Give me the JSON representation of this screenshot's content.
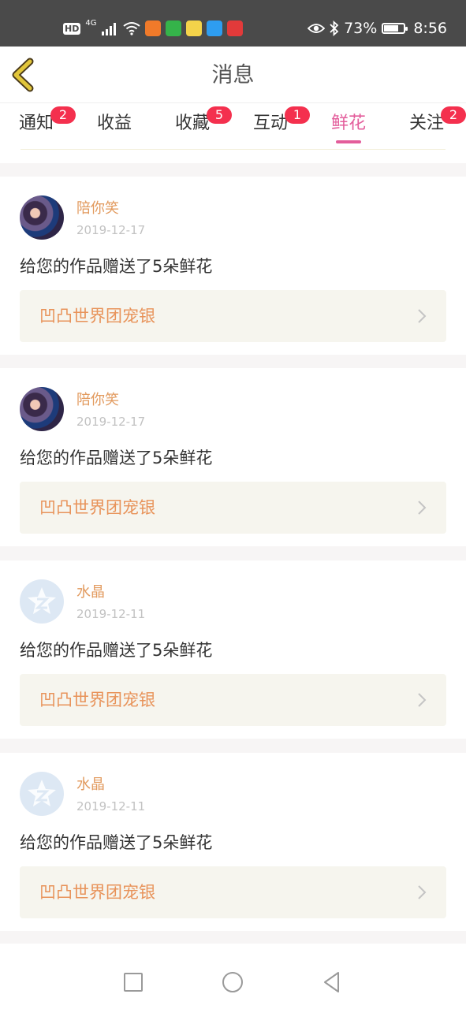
{
  "status_bar": {
    "hd": "HD",
    "network": "4G",
    "battery_text": "73%",
    "battery_level": 0.73,
    "time": "8:56",
    "icons": [
      "signal-icon",
      "wifi-icon",
      "eye-icon",
      "bluetooth-icon",
      "battery-icon"
    ]
  },
  "header": {
    "title": "消息",
    "back_icon": "chevron-left-icon",
    "accent": "#e2c63a"
  },
  "tabs": [
    {
      "label": "通知",
      "badge": "2"
    },
    {
      "label": "收益",
      "badge": ""
    },
    {
      "label": "收藏",
      "badge": "5"
    },
    {
      "label": "互动",
      "badge": "1"
    },
    {
      "label": "鲜花",
      "badge": "",
      "active": true
    },
    {
      "label": "关注",
      "badge": "2"
    }
  ],
  "messages": [
    {
      "name": "陪你笑",
      "date": "2019-12-17",
      "text": "给您的作品赠送了5朵鲜花",
      "work_title": "凹凸世界团宠银",
      "avatar": "photo"
    },
    {
      "name": "陪你笑",
      "date": "2019-12-17",
      "text": "给您的作品赠送了5朵鲜花",
      "work_title": "凹凸世界团宠银",
      "avatar": "photo"
    },
    {
      "name": "水晶",
      "date": "2019-12-11",
      "text": "给您的作品赠送了5朵鲜花",
      "work_title": "凹凸世界团宠银",
      "avatar": "qq-icon"
    },
    {
      "name": "水晶",
      "date": "2019-12-11",
      "text": "给您的作品赠送了5朵鲜花",
      "work_title": "凹凸世界团宠银",
      "avatar": "qq-icon"
    }
  ],
  "colors": {
    "active_tab": "#e35d9b",
    "badge": "#f4304e",
    "username": "#e29a5e",
    "work_title": "#e8935a"
  },
  "nav_bar": {
    "icons": [
      "recents-square-icon",
      "home-circle-icon",
      "back-triangle-icon"
    ]
  }
}
